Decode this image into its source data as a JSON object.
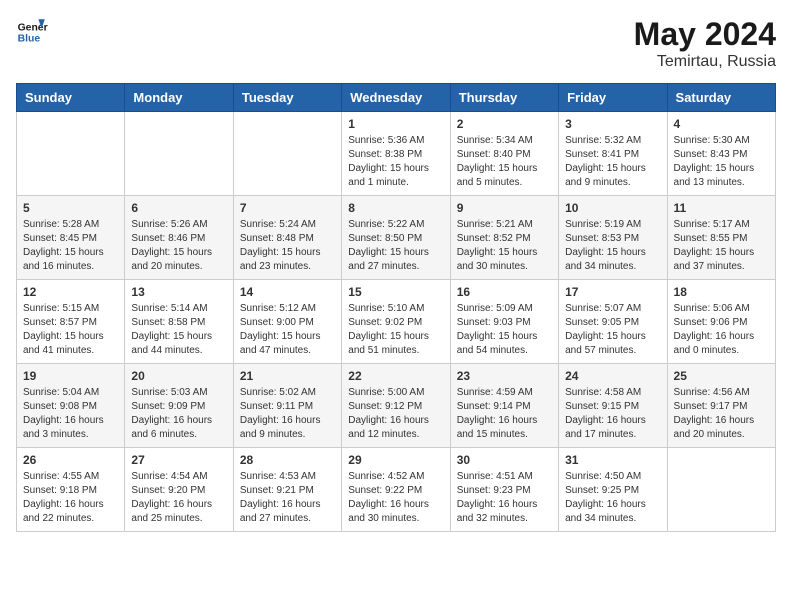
{
  "header": {
    "logo_line1": "General",
    "logo_line2": "Blue",
    "month": "May 2024",
    "location": "Temirtau, Russia"
  },
  "weekdays": [
    "Sunday",
    "Monday",
    "Tuesday",
    "Wednesday",
    "Thursday",
    "Friday",
    "Saturday"
  ],
  "weeks": [
    [
      {
        "day": "",
        "info": ""
      },
      {
        "day": "",
        "info": ""
      },
      {
        "day": "",
        "info": ""
      },
      {
        "day": "1",
        "info": "Sunrise: 5:36 AM\nSunset: 8:38 PM\nDaylight: 15 hours\nand 1 minute."
      },
      {
        "day": "2",
        "info": "Sunrise: 5:34 AM\nSunset: 8:40 PM\nDaylight: 15 hours\nand 5 minutes."
      },
      {
        "day": "3",
        "info": "Sunrise: 5:32 AM\nSunset: 8:41 PM\nDaylight: 15 hours\nand 9 minutes."
      },
      {
        "day": "4",
        "info": "Sunrise: 5:30 AM\nSunset: 8:43 PM\nDaylight: 15 hours\nand 13 minutes."
      }
    ],
    [
      {
        "day": "5",
        "info": "Sunrise: 5:28 AM\nSunset: 8:45 PM\nDaylight: 15 hours\nand 16 minutes."
      },
      {
        "day": "6",
        "info": "Sunrise: 5:26 AM\nSunset: 8:46 PM\nDaylight: 15 hours\nand 20 minutes."
      },
      {
        "day": "7",
        "info": "Sunrise: 5:24 AM\nSunset: 8:48 PM\nDaylight: 15 hours\nand 23 minutes."
      },
      {
        "day": "8",
        "info": "Sunrise: 5:22 AM\nSunset: 8:50 PM\nDaylight: 15 hours\nand 27 minutes."
      },
      {
        "day": "9",
        "info": "Sunrise: 5:21 AM\nSunset: 8:52 PM\nDaylight: 15 hours\nand 30 minutes."
      },
      {
        "day": "10",
        "info": "Sunrise: 5:19 AM\nSunset: 8:53 PM\nDaylight: 15 hours\nand 34 minutes."
      },
      {
        "day": "11",
        "info": "Sunrise: 5:17 AM\nSunset: 8:55 PM\nDaylight: 15 hours\nand 37 minutes."
      }
    ],
    [
      {
        "day": "12",
        "info": "Sunrise: 5:15 AM\nSunset: 8:57 PM\nDaylight: 15 hours\nand 41 minutes."
      },
      {
        "day": "13",
        "info": "Sunrise: 5:14 AM\nSunset: 8:58 PM\nDaylight: 15 hours\nand 44 minutes."
      },
      {
        "day": "14",
        "info": "Sunrise: 5:12 AM\nSunset: 9:00 PM\nDaylight: 15 hours\nand 47 minutes."
      },
      {
        "day": "15",
        "info": "Sunrise: 5:10 AM\nSunset: 9:02 PM\nDaylight: 15 hours\nand 51 minutes."
      },
      {
        "day": "16",
        "info": "Sunrise: 5:09 AM\nSunset: 9:03 PM\nDaylight: 15 hours\nand 54 minutes."
      },
      {
        "day": "17",
        "info": "Sunrise: 5:07 AM\nSunset: 9:05 PM\nDaylight: 15 hours\nand 57 minutes."
      },
      {
        "day": "18",
        "info": "Sunrise: 5:06 AM\nSunset: 9:06 PM\nDaylight: 16 hours\nand 0 minutes."
      }
    ],
    [
      {
        "day": "19",
        "info": "Sunrise: 5:04 AM\nSunset: 9:08 PM\nDaylight: 16 hours\nand 3 minutes."
      },
      {
        "day": "20",
        "info": "Sunrise: 5:03 AM\nSunset: 9:09 PM\nDaylight: 16 hours\nand 6 minutes."
      },
      {
        "day": "21",
        "info": "Sunrise: 5:02 AM\nSunset: 9:11 PM\nDaylight: 16 hours\nand 9 minutes."
      },
      {
        "day": "22",
        "info": "Sunrise: 5:00 AM\nSunset: 9:12 PM\nDaylight: 16 hours\nand 12 minutes."
      },
      {
        "day": "23",
        "info": "Sunrise: 4:59 AM\nSunset: 9:14 PM\nDaylight: 16 hours\nand 15 minutes."
      },
      {
        "day": "24",
        "info": "Sunrise: 4:58 AM\nSunset: 9:15 PM\nDaylight: 16 hours\nand 17 minutes."
      },
      {
        "day": "25",
        "info": "Sunrise: 4:56 AM\nSunset: 9:17 PM\nDaylight: 16 hours\nand 20 minutes."
      }
    ],
    [
      {
        "day": "26",
        "info": "Sunrise: 4:55 AM\nSunset: 9:18 PM\nDaylight: 16 hours\nand 22 minutes."
      },
      {
        "day": "27",
        "info": "Sunrise: 4:54 AM\nSunset: 9:20 PM\nDaylight: 16 hours\nand 25 minutes."
      },
      {
        "day": "28",
        "info": "Sunrise: 4:53 AM\nSunset: 9:21 PM\nDaylight: 16 hours\nand 27 minutes."
      },
      {
        "day": "29",
        "info": "Sunrise: 4:52 AM\nSunset: 9:22 PM\nDaylight: 16 hours\nand 30 minutes."
      },
      {
        "day": "30",
        "info": "Sunrise: 4:51 AM\nSunset: 9:23 PM\nDaylight: 16 hours\nand 32 minutes."
      },
      {
        "day": "31",
        "info": "Sunrise: 4:50 AM\nSunset: 9:25 PM\nDaylight: 16 hours\nand 34 minutes."
      },
      {
        "day": "",
        "info": ""
      }
    ]
  ]
}
